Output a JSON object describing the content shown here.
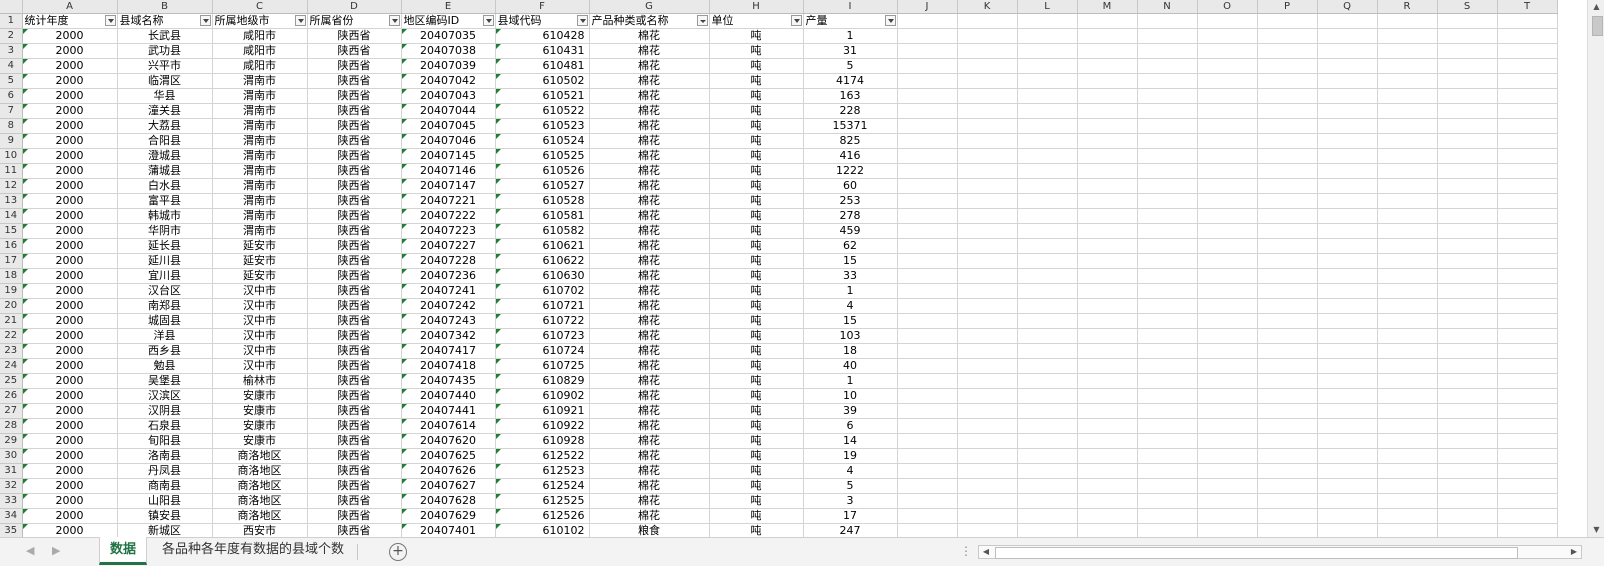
{
  "columns": [
    "A",
    "B",
    "C",
    "D",
    "E",
    "F",
    "G",
    "H",
    "I",
    "J",
    "K",
    "L",
    "M",
    "N",
    "O",
    "P",
    "Q",
    "R",
    "S",
    "T"
  ],
  "header_row_number": "1",
  "headers": [
    "统计年度",
    "县域名称",
    "所属地级市",
    "所属省份",
    "地区编码ID",
    "县域代码",
    "产品种类或名称",
    "单位",
    "产量"
  ],
  "rows": [
    [
      "2",
      "2000",
      "长武县",
      "咸阳市",
      "陕西省",
      "20407035",
      "610428",
      "棉花",
      "吨",
      "1"
    ],
    [
      "3",
      "2000",
      "武功县",
      "咸阳市",
      "陕西省",
      "20407038",
      "610431",
      "棉花",
      "吨",
      "31"
    ],
    [
      "4",
      "2000",
      "兴平市",
      "咸阳市",
      "陕西省",
      "20407039",
      "610481",
      "棉花",
      "吨",
      "5"
    ],
    [
      "5",
      "2000",
      "临渭区",
      "渭南市",
      "陕西省",
      "20407042",
      "610502",
      "棉花",
      "吨",
      "4174"
    ],
    [
      "6",
      "2000",
      "华县",
      "渭南市",
      "陕西省",
      "20407043",
      "610521",
      "棉花",
      "吨",
      "163"
    ],
    [
      "7",
      "2000",
      "潼关县",
      "渭南市",
      "陕西省",
      "20407044",
      "610522",
      "棉花",
      "吨",
      "228"
    ],
    [
      "8",
      "2000",
      "大荔县",
      "渭南市",
      "陕西省",
      "20407045",
      "610523",
      "棉花",
      "吨",
      "15371"
    ],
    [
      "9",
      "2000",
      "合阳县",
      "渭南市",
      "陕西省",
      "20407046",
      "610524",
      "棉花",
      "吨",
      "825"
    ],
    [
      "10",
      "2000",
      "澄城县",
      "渭南市",
      "陕西省",
      "20407145",
      "610525",
      "棉花",
      "吨",
      "416"
    ],
    [
      "11",
      "2000",
      "蒲城县",
      "渭南市",
      "陕西省",
      "20407146",
      "610526",
      "棉花",
      "吨",
      "1222"
    ],
    [
      "12",
      "2000",
      "白水县",
      "渭南市",
      "陕西省",
      "20407147",
      "610527",
      "棉花",
      "吨",
      "60"
    ],
    [
      "13",
      "2000",
      "富平县",
      "渭南市",
      "陕西省",
      "20407221",
      "610528",
      "棉花",
      "吨",
      "253"
    ],
    [
      "14",
      "2000",
      "韩城市",
      "渭南市",
      "陕西省",
      "20407222",
      "610581",
      "棉花",
      "吨",
      "278"
    ],
    [
      "15",
      "2000",
      "华阴市",
      "渭南市",
      "陕西省",
      "20407223",
      "610582",
      "棉花",
      "吨",
      "459"
    ],
    [
      "16",
      "2000",
      "延长县",
      "延安市",
      "陕西省",
      "20407227",
      "610621",
      "棉花",
      "吨",
      "62"
    ],
    [
      "17",
      "2000",
      "延川县",
      "延安市",
      "陕西省",
      "20407228",
      "610622",
      "棉花",
      "吨",
      "15"
    ],
    [
      "18",
      "2000",
      "宜川县",
      "延安市",
      "陕西省",
      "20407236",
      "610630",
      "棉花",
      "吨",
      "33"
    ],
    [
      "19",
      "2000",
      "汉台区",
      "汉中市",
      "陕西省",
      "20407241",
      "610702",
      "棉花",
      "吨",
      "1"
    ],
    [
      "20",
      "2000",
      "南郑县",
      "汉中市",
      "陕西省",
      "20407242",
      "610721",
      "棉花",
      "吨",
      "4"
    ],
    [
      "21",
      "2000",
      "城固县",
      "汉中市",
      "陕西省",
      "20407243",
      "610722",
      "棉花",
      "吨",
      "15"
    ],
    [
      "22",
      "2000",
      "洋县",
      "汉中市",
      "陕西省",
      "20407342",
      "610723",
      "棉花",
      "吨",
      "103"
    ],
    [
      "23",
      "2000",
      "西乡县",
      "汉中市",
      "陕西省",
      "20407417",
      "610724",
      "棉花",
      "吨",
      "18"
    ],
    [
      "24",
      "2000",
      "勉县",
      "汉中市",
      "陕西省",
      "20407418",
      "610725",
      "棉花",
      "吨",
      "40"
    ],
    [
      "25",
      "2000",
      "吴堡县",
      "榆林市",
      "陕西省",
      "20407435",
      "610829",
      "棉花",
      "吨",
      "1"
    ],
    [
      "26",
      "2000",
      "汉滨区",
      "安康市",
      "陕西省",
      "20407440",
      "610902",
      "棉花",
      "吨",
      "10"
    ],
    [
      "27",
      "2000",
      "汉阴县",
      "安康市",
      "陕西省",
      "20407441",
      "610921",
      "棉花",
      "吨",
      "39"
    ],
    [
      "28",
      "2000",
      "石泉县",
      "安康市",
      "陕西省",
      "20407614",
      "610922",
      "棉花",
      "吨",
      "6"
    ],
    [
      "29",
      "2000",
      "旬阳县",
      "安康市",
      "陕西省",
      "20407620",
      "610928",
      "棉花",
      "吨",
      "14"
    ],
    [
      "30",
      "2000",
      "洛南县",
      "商洛地区",
      "陕西省",
      "20407625",
      "612522",
      "棉花",
      "吨",
      "19"
    ],
    [
      "31",
      "2000",
      "丹凤县",
      "商洛地区",
      "陕西省",
      "20407626",
      "612523",
      "棉花",
      "吨",
      "4"
    ],
    [
      "32",
      "2000",
      "商南县",
      "商洛地区",
      "陕西省",
      "20407627",
      "612524",
      "棉花",
      "吨",
      "5"
    ],
    [
      "33",
      "2000",
      "山阳县",
      "商洛地区",
      "陕西省",
      "20407628",
      "612525",
      "棉花",
      "吨",
      "3"
    ],
    [
      "34",
      "2000",
      "镇安县",
      "商洛地区",
      "陕西省",
      "20407629",
      "612526",
      "棉花",
      "吨",
      "17"
    ],
    [
      "35",
      "2000",
      "新城区",
      "西安市",
      "陕西省",
      "20407401",
      "610102",
      "粮食",
      "吨",
      "247"
    ]
  ],
  "sheet_tabs": [
    {
      "label": "数据",
      "active": true
    },
    {
      "label": "各品种各年度有数据的县域个数",
      "active": false
    }
  ],
  "icons": {
    "nav_prev": "◀",
    "nav_next": "▶",
    "add_sheet": "+",
    "dots": "⋮",
    "scroll_up": "▲",
    "scroll_down": "▼",
    "scroll_left": "◀",
    "scroll_right": "▶"
  },
  "colors": {
    "active_tab": "#217346",
    "error_triangle": "#1e7e34",
    "header_bg": "#e9e9e9"
  }
}
